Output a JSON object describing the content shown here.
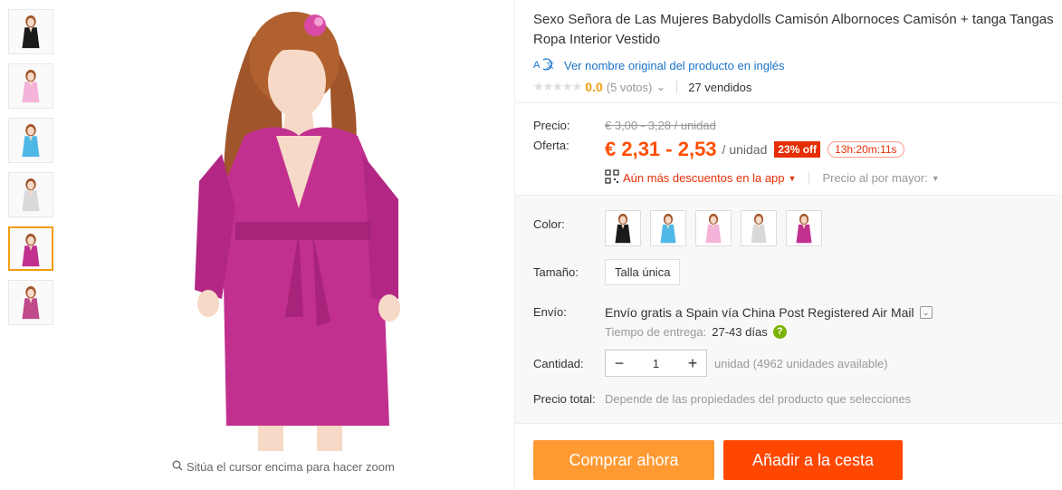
{
  "gallery": {
    "thumbnails": [
      {
        "color": "#1a1a1a"
      },
      {
        "color": "#f4b3d8"
      },
      {
        "color": "#4fb8e6"
      },
      {
        "color": "#d9d9d9"
      },
      {
        "color": "#c2308f"
      },
      {
        "color": "#c04a8a"
      }
    ],
    "active_index": 4,
    "zoom_hint": "Sitúa el cursor encima para hacer zoom"
  },
  "product": {
    "title": "Sexo Señora de Las Mujeres Babydolls Camisón Albornoces Camisón + tanga Tangas Ropa Interior Vestido",
    "translate_link": "Ver nombre original del producto en inglés",
    "rating": "0.0",
    "votes": "(5 votos)",
    "sold": "27 vendidos"
  },
  "price": {
    "price_label": "Precio:",
    "old_price": "€ 3,00 - 3,28 / unidad",
    "offer_label": "Oferta:",
    "offer_price": "€ 2,31 - 2,53",
    "unit": "/ unidad",
    "discount": "23% off",
    "timer": "13h:20m:11s",
    "app_discount": "Aún más descuentos en la app",
    "wholesale": "Precio al por mayor:"
  },
  "options": {
    "color_label": "Color:",
    "colors": [
      {
        "color": "#1a1a1a"
      },
      {
        "color": "#4fb8e6"
      },
      {
        "color": "#f4b3d8"
      },
      {
        "color": "#d9d9d9"
      },
      {
        "color": "#c2308f"
      }
    ],
    "size_label": "Tamaño:",
    "size_value": "Talla única",
    "shipping_label": "Envío:",
    "shipping_text": "Envío gratis a Spain vía China Post Registered Air Mail",
    "delivery_label": "Tiempo de entrega:",
    "delivery_value": "27-43 días",
    "quantity_label": "Cantidad:",
    "quantity_value": "1",
    "available": "unidad (4962 unidades available)",
    "total_label": "Precio total:",
    "total_note": "Depende de las propiedades del producto que selecciones"
  },
  "actions": {
    "buy_now": "Comprar ahora",
    "add_to_cart": "Añadir a la cesta"
  }
}
